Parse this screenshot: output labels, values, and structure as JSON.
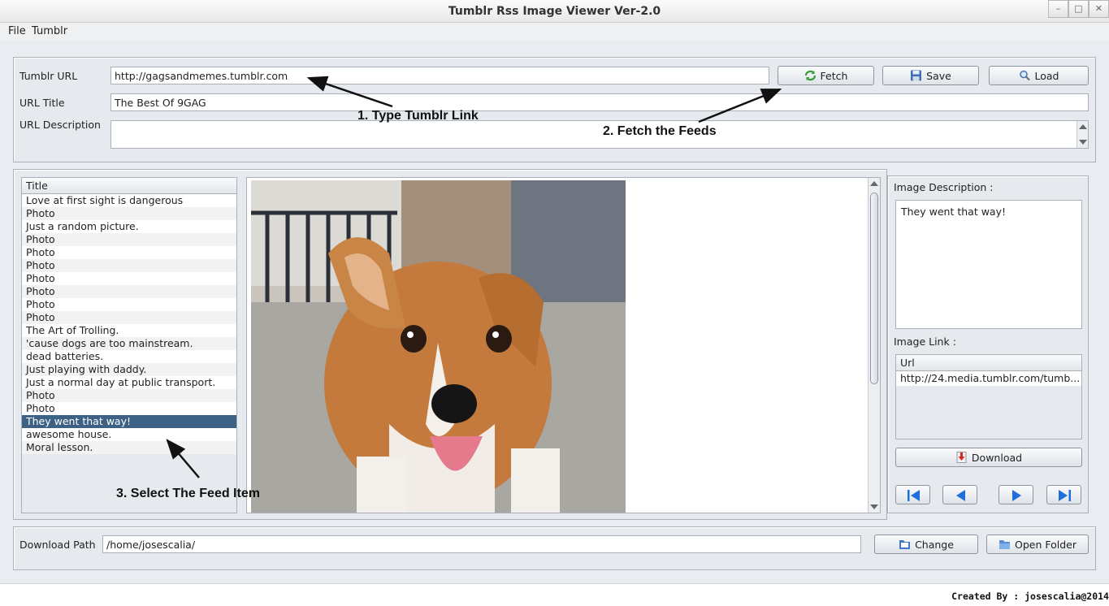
{
  "window": {
    "title": "Tumblr Rss Image Viewer Ver-2.0",
    "minimize": "–",
    "maximize": "□",
    "close": "✕"
  },
  "menu": [
    "File",
    "Tumblr"
  ],
  "url_panel": {
    "url_label": "Tumblr URL",
    "url_value": "http://gagsandmemes.tumblr.com",
    "title_label": "URL Title",
    "title_value": "The Best Of 9GAG",
    "desc_label": "URL Description",
    "desc_value": "",
    "fetch_label": "Fetch",
    "save_label": "Save",
    "load_label": "Load"
  },
  "feed_list": {
    "header": "Title",
    "items": [
      "Love at first sight is dangerous",
      "Photo",
      "Just a random picture.",
      "Photo",
      "Photo",
      "Photo",
      "Photo",
      "Photo",
      "Photo",
      "Photo",
      "The Art of Trolling.",
      "'cause dogs are too mainstream.",
      "dead batteries.",
      "Just playing with daddy.",
      "Just a normal day at public transport.",
      "Photo",
      "Photo",
      "They went that way!",
      "awesome house.",
      "Moral lesson."
    ],
    "selected_index": 17
  },
  "details": {
    "desc_label": "Image Description :",
    "desc_value": "They went that way!",
    "link_label": "Image Link :",
    "link_header": "Url",
    "link_value": "http://24.media.tumblr.com/tumb...",
    "download_label": "Download"
  },
  "download_bar": {
    "path_label": "Download Path",
    "path_value": "/home/josescalia/",
    "change_label": "Change",
    "open_folder_label": "Open Folder"
  },
  "annotations": {
    "step1": "1. Type Tumblr Link",
    "step2": "2. Fetch the Feeds",
    "step3": "3. Select The Feed Item"
  },
  "footer": {
    "credit": "Created By : josescalia@2014"
  },
  "colors": {
    "selection": "#3d6185",
    "nav_arrow": "#1e6fd9",
    "background": "#e6e9ed"
  }
}
